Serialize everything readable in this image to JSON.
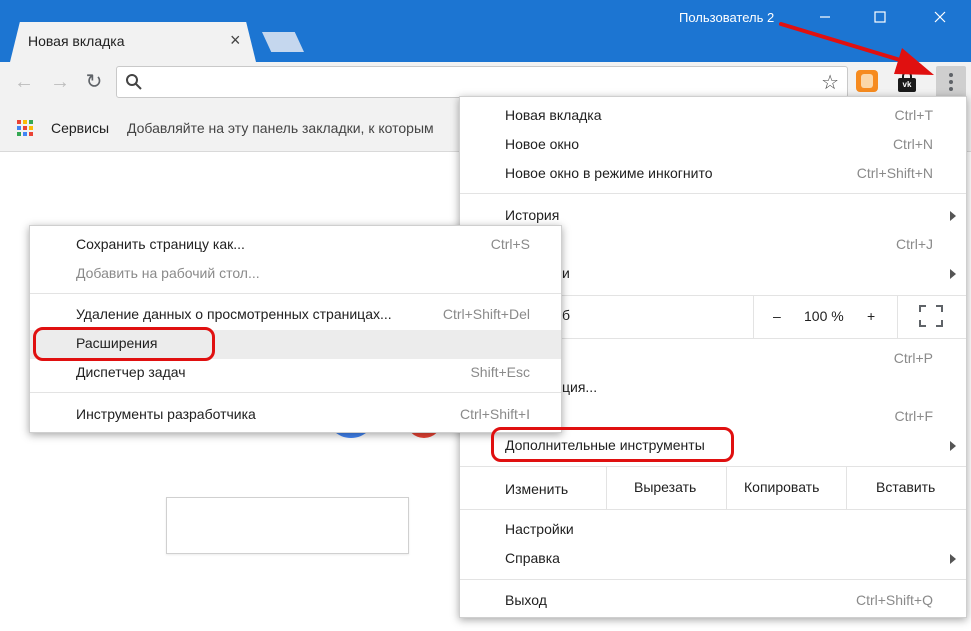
{
  "window": {
    "user_label": "Пользователь 2",
    "minimize_icon": "minimize-icon",
    "maximize_icon": "maximize-icon",
    "close_icon": "close-icon"
  },
  "tabs": {
    "active_title": "Новая вкладка",
    "close_glyph": "×"
  },
  "toolbar": {
    "back_glyph": "←",
    "forward_glyph": "→",
    "reload_glyph": "↻",
    "search_glyph": "⚲",
    "star_glyph": "☆",
    "omnibox_value": "",
    "vk_label": "vk"
  },
  "bookmarks": {
    "services": "Сервисы",
    "hint": "Добавляйте на эту панель закладки, к которым"
  },
  "main_menu": {
    "new_tab": {
      "label": "Новая вкладка",
      "shortcut": "Ctrl+T"
    },
    "new_window": {
      "label": "Новое окно",
      "shortcut": "Ctrl+N"
    },
    "incognito": {
      "label": "Новое окно в режиме инкогнито",
      "shortcut": "Ctrl+Shift+N"
    },
    "history": {
      "label": "История"
    },
    "downloads": {
      "label": "",
      "shortcut": "Ctrl+J"
    },
    "bookmarks": {
      "label": "и"
    },
    "zoom": {
      "label": "б",
      "minus": "–",
      "value": "100 %",
      "plus": "+"
    },
    "print": {
      "label": "",
      "shortcut": "Ctrl+P"
    },
    "cast": {
      "label": "ция..."
    },
    "find": {
      "label": "",
      "shortcut": "Ctrl+F"
    },
    "more_tools": {
      "label": "Дополнительные инструменты"
    },
    "edit": {
      "label": "Изменить",
      "cut": "Вырезать",
      "copy": "Копировать",
      "paste": "Вставить"
    },
    "settings": {
      "label": "Настройки"
    },
    "help": {
      "label": "Справка"
    },
    "exit": {
      "label": "Выход",
      "shortcut": "Ctrl+Shift+Q"
    }
  },
  "sub_menu": {
    "save_page": {
      "label": "Сохранить страницу как...",
      "shortcut": "Ctrl+S"
    },
    "add_desktop": {
      "label": "Добавить на рабочий стол..."
    },
    "clear_data": {
      "label": "Удаление данных о просмотренных страницах...",
      "shortcut": "Ctrl+Shift+Del"
    },
    "extensions": {
      "label": "Расширения"
    },
    "task_manager": {
      "label": "Диспетчер задач",
      "shortcut": "Shift+Esc"
    },
    "dev_tools": {
      "label": "Инструменты разработчика",
      "shortcut": "Ctrl+Shift+I"
    }
  },
  "colors": {
    "titlebar": "#1c75d2",
    "annotation_red": "#e01010"
  }
}
